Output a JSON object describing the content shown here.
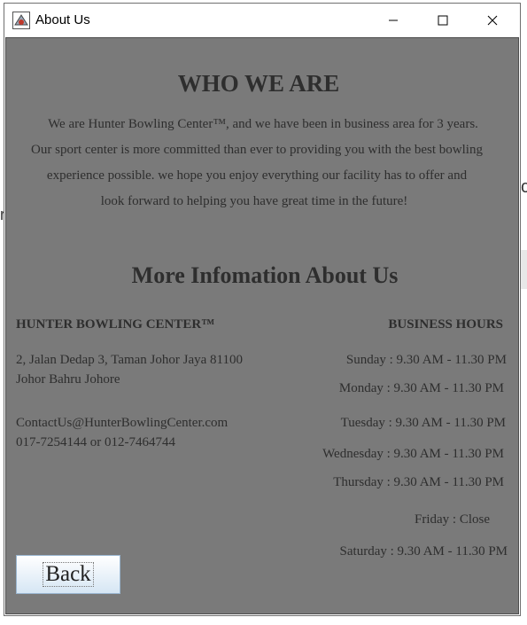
{
  "window": {
    "title": "About Us"
  },
  "controls": {
    "minimize": "minimize-icon",
    "maximize": "maximize-icon",
    "close": "close-icon"
  },
  "about": {
    "heading": "WHO WE ARE",
    "paragraph_lines": [
      "We are Hunter Bowling Center™, and we have been in business area for 3 years.",
      "Our sport center is more committed than ever to providing you with the best bowling",
      "experience possible. we hope you enjoy everything our facility has to offer and",
      "look forward to helping you have great time in the future!"
    ]
  },
  "more_info": {
    "heading": "More Infomation About Us",
    "company_name": "HUNTER BOWLING CENTER™",
    "address_line1": "2, Jalan Dedap 3, Taman Johor Jaya 81100",
    "address_line2": "Johor Bahru Johore",
    "email": "ContactUs@HunterBowlingCenter.com",
    "phones": "017-7254144 or 012-7464744"
  },
  "hours": {
    "heading": "BUSINESS HOURS",
    "days": [
      "Sunday : 9.30 AM - 11.30 PM",
      "Monday : 9.30 AM - 11.30 PM",
      "Tuesday : 9.30 AM - 11.30 PM",
      "Wednesday : 9.30 AM - 11.30 PM",
      "Thursday : 9.30 AM - 11.30 PM",
      "Friday :  Close",
      "Saturday : 9.30 AM - 11.30 PM"
    ]
  },
  "back_button": {
    "label": "Back"
  }
}
